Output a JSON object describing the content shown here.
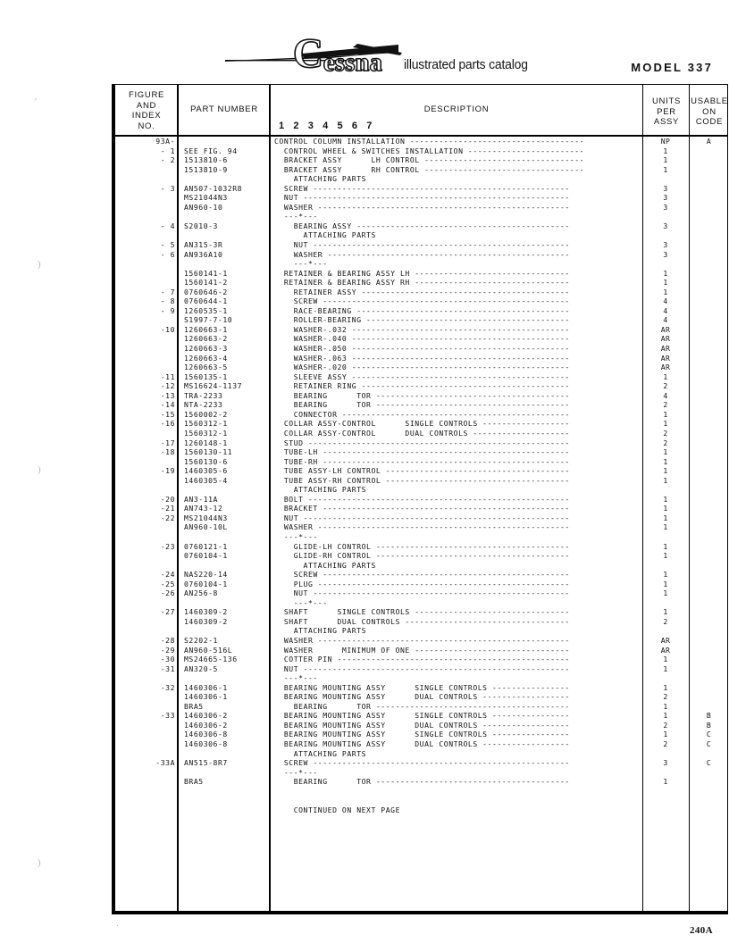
{
  "masthead": {
    "brand_c": "C",
    "brand_rest": "essna",
    "tagline": "illustrated parts catalog",
    "model": "MODEL  337"
  },
  "table": {
    "headers": {
      "figure_and_index": "FIGURE\nAND\nINDEX\nNO.",
      "part_number": "PART  NUMBER",
      "description": "DESCRIPTION",
      "units_per_assy": "UNITS\nPER\nASSY",
      "usable_on_code": "USABLE\nON\nCODE",
      "indent_scale": "1 2 3 4 5 6 7"
    },
    "rows": [
      {
        "index": "93A-",
        "part": "",
        "desc": "CONTROL COLUMN INSTALLATION ------------------------------------",
        "units": "NP",
        "code": "A"
      },
      {
        "index": "- 1",
        "part": "SEE FIG. 94",
        "desc": "  CONTROL WHEEL & SWITCHES INSTALLATION ------------------------",
        "units": "1",
        "code": ""
      },
      {
        "index": "- 2",
        "part": "1513810-6",
        "desc": "  BRACKET ASSY      LH CONTROL ---------------------------------",
        "units": "1",
        "code": ""
      },
      {
        "index": "",
        "part": "1513810-9",
        "desc": "  BRACKET ASSY      RH CONTROL ---------------------------------",
        "units": "1",
        "code": ""
      },
      {
        "index": "",
        "part": "",
        "desc": "    ATTACHING PARTS",
        "units": "",
        "code": ""
      },
      {
        "index": "- 3",
        "part": "AN507-1032R8",
        "desc": "  SCREW -----------------------------------------------------",
        "units": "3",
        "code": ""
      },
      {
        "index": "",
        "part": "MS21044N3",
        "desc": "  NUT -------------------------------------------------------",
        "units": "3",
        "code": ""
      },
      {
        "index": "",
        "part": "AN960-10",
        "desc": "  WASHER ----------------------------------------------------",
        "units": "3",
        "code": ""
      },
      {
        "index": "",
        "part": "",
        "desc": "  ---*---",
        "units": "",
        "code": ""
      },
      {
        "index": "- 4",
        "part": "S2010-3",
        "desc": "    BEARING ASSY --------------------------------------------",
        "units": "3",
        "code": ""
      },
      {
        "index": "",
        "part": "",
        "desc": "      ATTACHING PARTS",
        "units": "",
        "code": ""
      },
      {
        "index": "- 5",
        "part": "AN315-3R",
        "desc": "    NUT -----------------------------------------------------",
        "units": "3",
        "code": ""
      },
      {
        "index": "- 6",
        "part": "AN936A10",
        "desc": "    WASHER --------------------------------------------------",
        "units": "3",
        "code": ""
      },
      {
        "index": "",
        "part": "",
        "desc": "    ---*---",
        "units": "",
        "code": ""
      },
      {
        "index": "",
        "part": "1560141-1",
        "desc": "  RETAINER & BEARING ASSY LH --------------------------------",
        "units": "1",
        "code": ""
      },
      {
        "index": "",
        "part": "1560141-2",
        "desc": "  RETAINER & BEARING ASSY RH --------------------------------",
        "units": "1",
        "code": ""
      },
      {
        "index": "- 7",
        "part": "0760646-2",
        "desc": "    RETAINER ASSY -------------------------------------------",
        "units": "1",
        "code": ""
      },
      {
        "index": "- 8",
        "part": "0760644-1",
        "desc": "    SCREW ---------------------------------------------------",
        "units": "4",
        "code": ""
      },
      {
        "index": "- 9",
        "part": "1260535-1",
        "desc": "    RACE-BEARING --------------------------------------------",
        "units": "4",
        "code": ""
      },
      {
        "index": "",
        "part": "S1997-7-10",
        "desc": "    ROLLER-BEARING ------------------------------------------",
        "units": "4",
        "code": ""
      },
      {
        "index": "-10",
        "part": "1260663-1",
        "desc": "    WASHER-.032 ---------------------------------------------",
        "units": "AR",
        "code": ""
      },
      {
        "index": "",
        "part": "1260663-2",
        "desc": "    WASHER-.040 ---------------------------------------------",
        "units": "AR",
        "code": ""
      },
      {
        "index": "",
        "part": "1260663-3",
        "desc": "    WASHER-.050 ---------------------------------------------",
        "units": "AR",
        "code": ""
      },
      {
        "index": "",
        "part": "1260663-4",
        "desc": "    WASHER-.063 ---------------------------------------------",
        "units": "AR",
        "code": ""
      },
      {
        "index": "",
        "part": "1260663-5",
        "desc": "    WASHER-.020 ---------------------------------------------",
        "units": "AR",
        "code": ""
      },
      {
        "index": "-11",
        "part": "1560135-1",
        "desc": "    SLEEVE ASSY ---------------------------------------------",
        "units": "1",
        "code": ""
      },
      {
        "index": "-12",
        "part": "MS16624-1137",
        "desc": "    RETAINER RING -------------------------------------------",
        "units": "2",
        "code": ""
      },
      {
        "index": "-13",
        "part": "TRA-2233",
        "desc": "    BEARING      TOR ----------------------------------------",
        "units": "4",
        "code": ""
      },
      {
        "index": "-14",
        "part": "NTA-2233",
        "desc": "    BEARING      TOR ----------------------------------------",
        "units": "2",
        "code": ""
      },
      {
        "index": "-15",
        "part": "1560002-2",
        "desc": "    CONNECTOR -----------------------------------------------",
        "units": "1",
        "code": ""
      },
      {
        "index": "-16",
        "part": "1560312-1",
        "desc": "  COLLAR ASSY-CONTROL      SINGLE CONTROLS ------------------",
        "units": "1",
        "code": ""
      },
      {
        "index": "",
        "part": "1560312-1",
        "desc": "  COLLAR ASSY-CONTROL      DUAL CONTROLS --------------------",
        "units": "2",
        "code": ""
      },
      {
        "index": "-17",
        "part": "1260148-1",
        "desc": "  STUD ------------------------------------------------------",
        "units": "2",
        "code": ""
      },
      {
        "index": "-18",
        "part": "1560130-11",
        "desc": "  TUBE-LH ---------------------------------------------------",
        "units": "1",
        "code": ""
      },
      {
        "index": "",
        "part": "1560130-6",
        "desc": "  TUBE-RH ---------------------------------------------------",
        "units": "1",
        "code": ""
      },
      {
        "index": "-19",
        "part": "1460305-6",
        "desc": "  TUBE ASSY-LH CONTROL --------------------------------------",
        "units": "1",
        "code": ""
      },
      {
        "index": "",
        "part": "1460305-4",
        "desc": "  TUBE ASSY-RH CONTROL --------------------------------------",
        "units": "1",
        "code": ""
      },
      {
        "index": "",
        "part": "",
        "desc": "    ATTACHING PARTS",
        "units": "",
        "code": ""
      },
      {
        "index": "-20",
        "part": "AN3-11A",
        "desc": "  BOLT ------------------------------------------------------",
        "units": "1",
        "code": ""
      },
      {
        "index": "-21",
        "part": "AN743-12",
        "desc": "  BRACKET ---------------------------------------------------",
        "units": "1",
        "code": ""
      },
      {
        "index": "-22",
        "part": "MS21044N3",
        "desc": "  NUT -------------------------------------------------------",
        "units": "1",
        "code": ""
      },
      {
        "index": "",
        "part": "AN960-10L",
        "desc": "  WASHER ----------------------------------------------------",
        "units": "1",
        "code": ""
      },
      {
        "index": "",
        "part": "",
        "desc": "  ---*---",
        "units": "",
        "code": ""
      },
      {
        "index": "-23",
        "part": "0760121-1",
        "desc": "    GLIDE-LH CONTROL ----------------------------------------",
        "units": "1",
        "code": ""
      },
      {
        "index": "",
        "part": "0760104-1",
        "desc": "    GLIDE-RH CONTROL ----------------------------------------",
        "units": "1",
        "code": ""
      },
      {
        "index": "",
        "part": "",
        "desc": "      ATTACHING PARTS",
        "units": "",
        "code": ""
      },
      {
        "index": "-24",
        "part": "NAS220-14",
        "desc": "    SCREW ---------------------------------------------------",
        "units": "1",
        "code": ""
      },
      {
        "index": "-25",
        "part": "0760104-1",
        "desc": "    PLUG ----------------------------------------------------",
        "units": "1",
        "code": ""
      },
      {
        "index": "-26",
        "part": "AN256-8",
        "desc": "    NUT -----------------------------------------------------",
        "units": "1",
        "code": ""
      },
      {
        "index": "",
        "part": "",
        "desc": "    ---*---",
        "units": "",
        "code": ""
      },
      {
        "index": "-27",
        "part": "1460309-2",
        "desc": "  SHAFT      SINGLE CONTROLS --------------------------------",
        "units": "1",
        "code": ""
      },
      {
        "index": "",
        "part": "1460309-2",
        "desc": "  SHAFT      DUAL CONTROLS ----------------------------------",
        "units": "2",
        "code": ""
      },
      {
        "index": "",
        "part": "",
        "desc": "    ATTACHING PARTS",
        "units": "",
        "code": ""
      },
      {
        "index": "-28",
        "part": "S2202-1",
        "desc": "  WASHER ----------------------------------------------------",
        "units": "AR",
        "code": ""
      },
      {
        "index": "-29",
        "part": "AN960-516L",
        "desc": "  WASHER      MINIMUM OF ONE --------------------------------",
        "units": "AR",
        "code": ""
      },
      {
        "index": "-30",
        "part": "MS24665-136",
        "desc": "  COTTER PIN ------------------------------------------------",
        "units": "1",
        "code": ""
      },
      {
        "index": "-31",
        "part": "AN320-5",
        "desc": "  NUT -------------------------------------------------------",
        "units": "1",
        "code": ""
      },
      {
        "index": "",
        "part": "",
        "desc": "  ---*---",
        "units": "",
        "code": ""
      },
      {
        "index": "-32",
        "part": "1460306-1",
        "desc": "  BEARING MOUNTING ASSY      SINGLE CONTROLS ----------------",
        "units": "1",
        "code": ""
      },
      {
        "index": "",
        "part": "1460306-1",
        "desc": "  BEARING MOUNTING ASSY      DUAL CONTROLS ------------------",
        "units": "2",
        "code": ""
      },
      {
        "index": "",
        "part": "BRA5",
        "desc": "    BEARING      TOR ----------------------------------------",
        "units": "1",
        "code": ""
      },
      {
        "index": "-33",
        "part": "1460306-2",
        "desc": "  BEARING MOUNTING ASSY      SINGLE CONTROLS ----------------",
        "units": "1",
        "code": "B"
      },
      {
        "index": "",
        "part": "1460306-2",
        "desc": "  BEARING MOUNTING ASSY      DUAL CONTROLS ------------------",
        "units": "2",
        "code": "B"
      },
      {
        "index": "",
        "part": "1460306-8",
        "desc": "  BEARING MOUNTING ASSY      SINGLE CONTROLS ----------------",
        "units": "1",
        "code": "C"
      },
      {
        "index": "",
        "part": "1460306-8",
        "desc": "  BEARING MOUNTING ASSY      DUAL CONTROLS ------------------",
        "units": "2",
        "code": "C"
      },
      {
        "index": "",
        "part": "",
        "desc": "    ATTACHING PARTS",
        "units": "",
        "code": ""
      },
      {
        "index": "-33A",
        "part": "AN515-8R7",
        "desc": "  SCREW -----------------------------------------------------",
        "units": "3",
        "code": "C"
      },
      {
        "index": "",
        "part": "",
        "desc": "  ---*---",
        "units": "",
        "code": ""
      },
      {
        "index": "",
        "part": "BRA5",
        "desc": "    BEARING      TOR ----------------------------------------",
        "units": "1",
        "code": ""
      },
      {
        "index": "",
        "part": "",
        "desc": "",
        "units": "",
        "code": ""
      },
      {
        "index": "",
        "part": "",
        "desc": "",
        "units": "",
        "code": ""
      },
      {
        "index": "",
        "part": "",
        "desc": "    CONTINUED ON NEXT PAGE",
        "units": "",
        "code": ""
      }
    ]
  },
  "footer": {
    "page_number": "240A"
  }
}
